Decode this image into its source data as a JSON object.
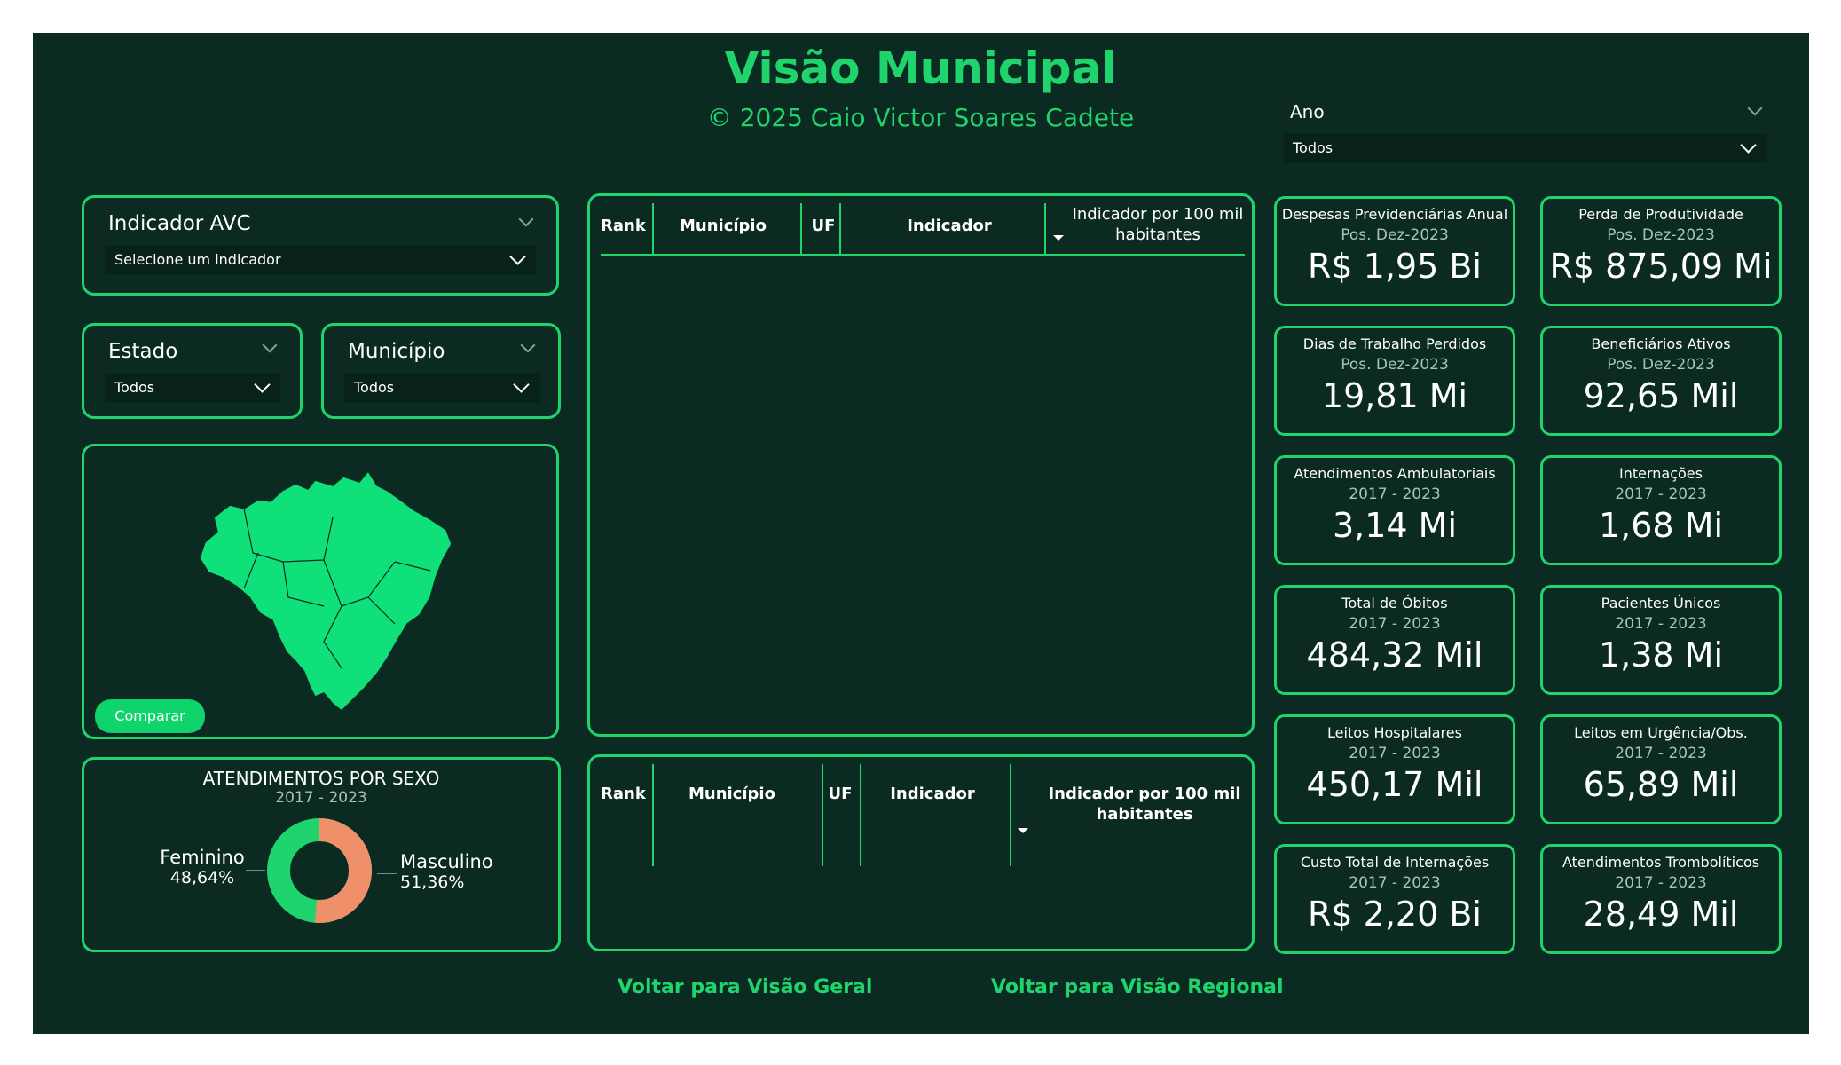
{
  "header": {
    "title": "Visão Municipal",
    "subtitle": "© 2025 Caio Victor Soares Cadete"
  },
  "filters": {
    "ano": {
      "label": "Ano",
      "value": "Todos"
    },
    "indicador": {
      "label": "Indicador AVC",
      "value": "Selecione um indicador"
    },
    "estado": {
      "label": "Estado",
      "value": "Todos"
    },
    "municipio": {
      "label": "Município",
      "value": "Todos"
    }
  },
  "map": {
    "compare_button": "Comparar"
  },
  "sex_chart": {
    "title": "ATENDIMENTOS POR SEXO",
    "period": "2017 - 2023",
    "feminino": {
      "label": "Feminino",
      "value": "48,64%",
      "pct": 48.64,
      "color": "#1fd46c"
    },
    "masculino": {
      "label": "Masculino",
      "value": "51,36%",
      "pct": 51.36,
      "color": "#f0906a"
    }
  },
  "table_top": {
    "headers": [
      "Rank",
      "Município",
      "UF",
      "Indicador",
      "Indicador por 100 mil habitantes"
    ]
  },
  "table_bottom": {
    "headers": [
      "Rank",
      "Município",
      "UF",
      "Indicador",
      "Indicador por 100 mil habitantes"
    ]
  },
  "kpis": [
    {
      "title": "Despesas Previdenciárias Anual",
      "sub": "Pos. Dez-2023",
      "value": "R$ 1,95 Bi"
    },
    {
      "title": "Perda de Produtividade",
      "sub": "Pos. Dez-2023",
      "value": "R$ 875,09 Mi"
    },
    {
      "title": "Dias de Trabalho Perdidos",
      "sub": "Pos. Dez-2023",
      "value": "19,81 Mi"
    },
    {
      "title": "Beneficiários Ativos",
      "sub": "Pos. Dez-2023",
      "value": "92,65 Mil"
    },
    {
      "title": "Atendimentos Ambulatoriais",
      "sub": "2017 - 2023",
      "value": "3,14 Mi"
    },
    {
      "title": "Internações",
      "sub": "2017 - 2023",
      "value": "1,68 Mi"
    },
    {
      "title": "Total de Óbitos",
      "sub": "2017 - 2023",
      "value": "484,32 Mil"
    },
    {
      "title": "Pacientes Únicos",
      "sub": "2017 - 2023",
      "value": "1,38 Mi"
    },
    {
      "title": "Leitos Hospitalares",
      "sub": "2017 - 2023",
      "value": "450,17 Mil"
    },
    {
      "title": "Leitos em Urgência/Obs.",
      "sub": "2017 - 2023",
      "value": "65,89 Mil"
    },
    {
      "title": "Custo Total de Internações",
      "sub": "2017 - 2023",
      "value": "R$ 2,20 Bi"
    },
    {
      "title": "Atendimentos Trombolíticos",
      "sub": "2017 - 2023",
      "value": "28,49 Mil"
    }
  ],
  "links": {
    "geral": "Voltar para Visão Geral",
    "regional": "Voltar para Visão Regional"
  }
}
